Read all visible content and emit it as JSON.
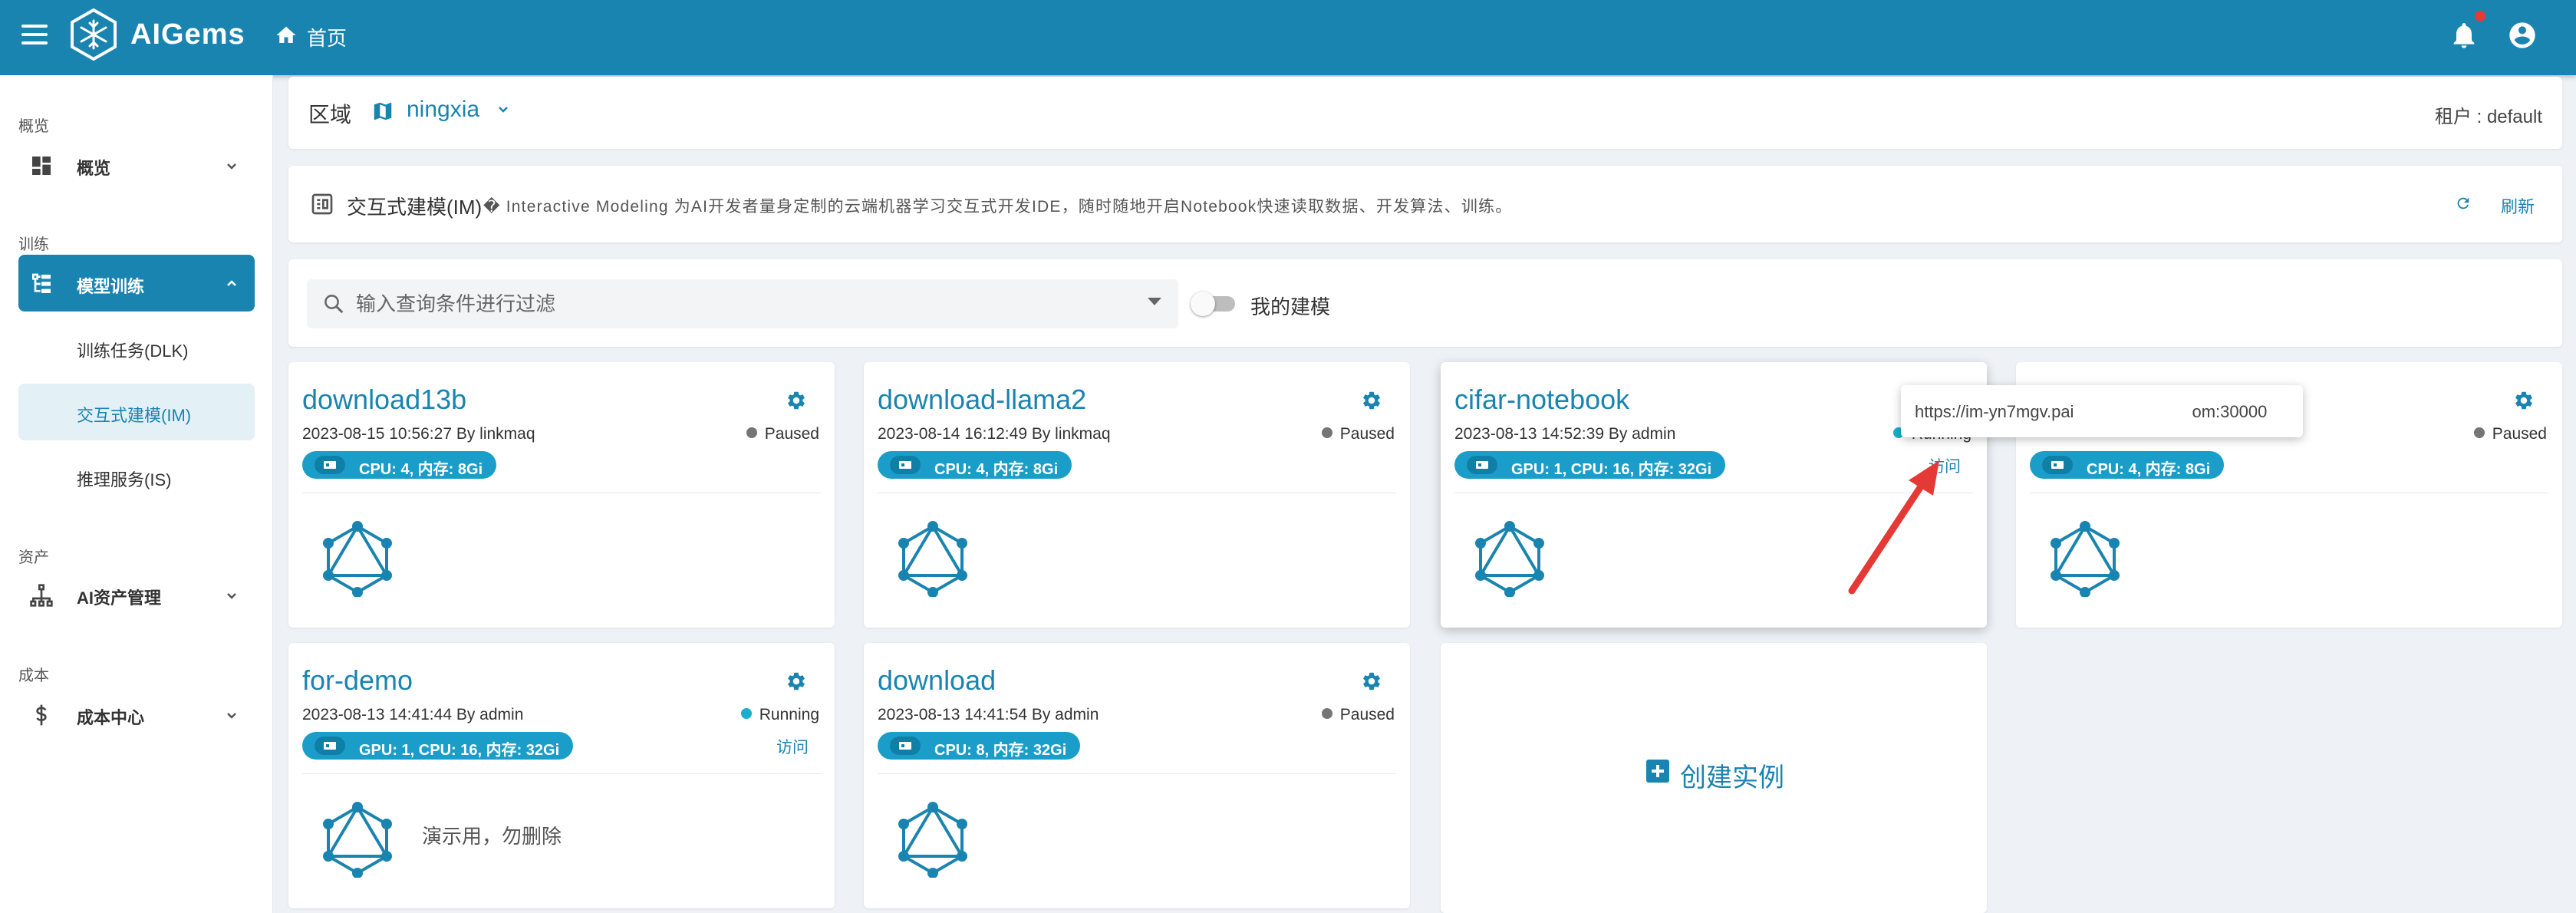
{
  "app": {
    "brand": "AIGems",
    "home_label": "首页"
  },
  "sidebar": {
    "sections": [
      {
        "title": "概览",
        "item": {
          "label": "概览",
          "icon": "dashboard-icon"
        }
      },
      {
        "title": "训练",
        "item": {
          "label": "模型训练",
          "icon": "hierarchy-icon",
          "expanded": true
        },
        "children": [
          {
            "label": "训练任务(DLK)",
            "active": false
          },
          {
            "label": "交互式建模(IM)",
            "active": true
          },
          {
            "label": "推理服务(IS)",
            "active": false
          }
        ]
      },
      {
        "title": "资产",
        "item": {
          "label": "AI资产管理",
          "icon": "sitemap-icon"
        }
      },
      {
        "title": "成本",
        "item": {
          "label": "成本中心",
          "icon": "dollar-icon"
        }
      }
    ]
  },
  "region": {
    "label": "区域",
    "value": "ningxia",
    "tenant": "租户 : default"
  },
  "description": {
    "title": "交互式建模(IM)",
    "text": "� Interactive Modeling 为AI开发者量身定制的云端机器学习交互式开发IDE，随时随地开启Notebook快速读取数据、开发算法、训练。",
    "refresh_label": "刷新"
  },
  "filter": {
    "placeholder": "输入查询条件进行过滤",
    "toggle_label": "我的建模",
    "toggle_on": false
  },
  "cards": [
    {
      "title": "download13b",
      "meta": "2023-08-15 10:56:27 By linkmaq",
      "status": "Paused",
      "resources": "CPU: 4, 内存: 8Gi",
      "visit": "",
      "note": ""
    },
    {
      "title": "download-llama2",
      "meta": "2023-08-14 16:12:49 By linkmaq",
      "status": "Paused",
      "resources": "CPU: 4, 内存: 8Gi",
      "visit": "",
      "note": ""
    },
    {
      "title": "cifar-notebook",
      "meta": "2023-08-13 14:52:39 By admin",
      "status": "Running",
      "resources": "GPU: 1, CPU: 16, 内存: 32Gi",
      "visit": "访问",
      "note": ""
    },
    {
      "title": "",
      "meta": "",
      "status": "Paused",
      "resources": "CPU: 4, 内存: 8Gi",
      "visit": "",
      "note": ""
    },
    {
      "title": "for-demo",
      "meta": "2023-08-13 14:41:44 By admin",
      "status": "Running",
      "resources": "GPU: 1, CPU: 16, 内存: 32Gi",
      "visit": "访问",
      "note": "演示用，勿删除"
    },
    {
      "title": "download",
      "meta": "2023-08-13 14:41:54 By admin",
      "status": "Paused",
      "resources": "CPU: 8, 内存: 32Gi",
      "visit": "",
      "note": ""
    }
  ],
  "create_label": "创建实例",
  "tooltip": {
    "url_left": "https://im-yn7mgv.pai",
    "url_right": "om:30000"
  },
  "colors": {
    "primary": "#1a84b0",
    "running": "#1ab0c9",
    "paused": "#757575",
    "chip": "#1a9ec9",
    "arrow": "#e53935"
  }
}
